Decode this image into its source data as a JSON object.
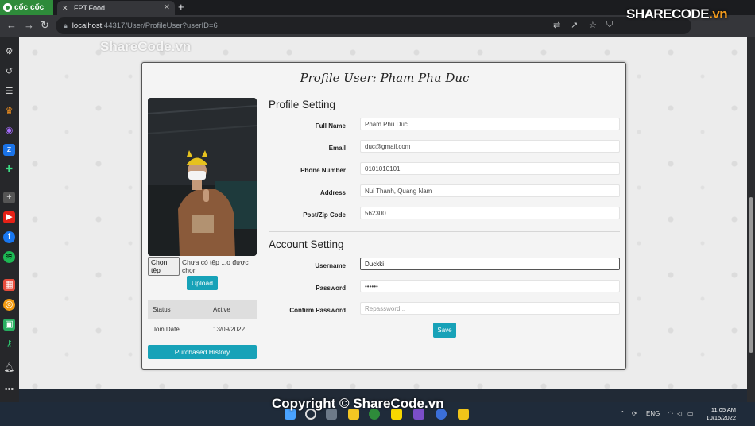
{
  "browser": {
    "brand": "cốc cốc",
    "tab_title": "FPT.Food",
    "url_host": "localhost",
    "url_path": ":44317/User/ProfileUser?userID=6"
  },
  "watermark": {
    "top": "ShareCode.vn",
    "logo": "SHARECODE",
    "logo_suffix": ".vn",
    "bottom": "Copyright © ShareCode.vn"
  },
  "profile": {
    "title": "Profile User: Pham Phu Duc",
    "file_button": "Chọn tệp",
    "file_status": "Chưa có tệp ...o được chọn",
    "upload_label": "Upload",
    "status_table": [
      {
        "label": "Status",
        "value": "Active"
      },
      {
        "label": "Join Date",
        "value": "13/09/2022"
      }
    ],
    "history_label": "Purchased History"
  },
  "profile_setting": {
    "heading": "Profile Setting",
    "fields": [
      {
        "label": "Full Name",
        "value": "Pham Phu Duc"
      },
      {
        "label": "Email",
        "value": "duc@gmail.com"
      },
      {
        "label": "Phone Number",
        "value": "0101010101"
      },
      {
        "label": "Address",
        "value": "Nui Thanh, Quang Nam"
      },
      {
        "label": "Post/Zip Code",
        "value": "562300"
      }
    ]
  },
  "account_setting": {
    "heading": "Account Setting",
    "username_label": "Username",
    "username_value": "Duckki",
    "password_label": "Password",
    "password_value": "••••••",
    "confirm_label": "Confirm Password",
    "confirm_placeholder": "Repassword...",
    "save_label": "Save"
  },
  "taskbar": {
    "language": "ENG",
    "time": "11:05 AM",
    "date": "10/15/2022"
  },
  "colors": {
    "accent": "#17a2b8",
    "brand": "#2e8b3a"
  }
}
